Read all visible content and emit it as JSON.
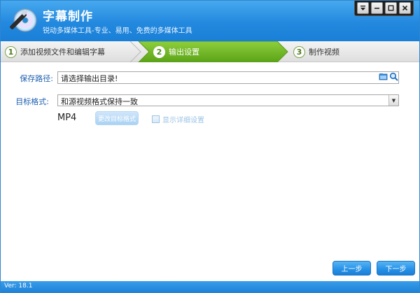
{
  "app": {
    "title": "字幕制作",
    "subtitle": "锐动多媒体工具-专业、易用、免费的多媒体工具"
  },
  "steps": [
    {
      "num": "1",
      "label": "添加视频文件和编辑字幕",
      "active": false
    },
    {
      "num": "2",
      "label": "输出设置",
      "active": true
    },
    {
      "num": "3",
      "label": "制作视频",
      "active": false
    }
  ],
  "form": {
    "save_path_label": "保存路径:",
    "save_path_value": "请选择输出目录!",
    "target_format_label": "目标格式:",
    "target_format_value": "和源视频格式保持一致",
    "format_value": "MP4",
    "change_format_button": "更改目标格式",
    "show_details_label": "显示详细设置"
  },
  "nav": {
    "prev": "上一步",
    "next": "下一步"
  },
  "status": {
    "version": "Ver: 18.1"
  },
  "colors": {
    "title_blue": "#2389df",
    "active_step_green": "#6bb324",
    "label_blue": "#1d5fb0"
  }
}
